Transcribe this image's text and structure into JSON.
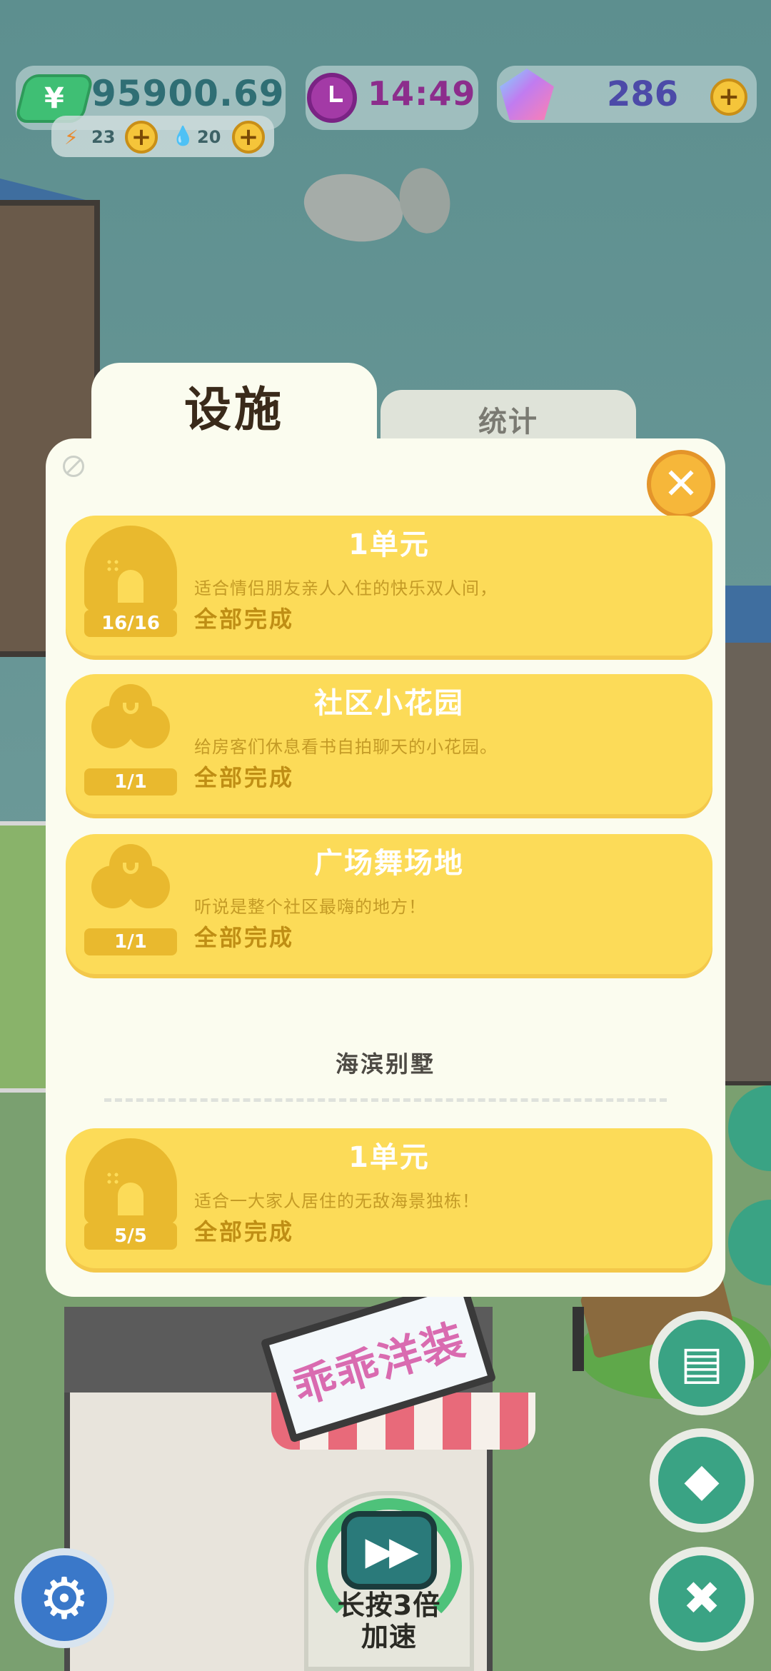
{
  "hud": {
    "money": "95900.69",
    "money_symbol": "¥",
    "energy": "23",
    "water": "20",
    "time": "14:49",
    "gems": "286",
    "plus": "+"
  },
  "tabs": [
    {
      "label": "设施",
      "active": true
    },
    {
      "label": "统计",
      "active": false
    }
  ],
  "close_symbol": "✕",
  "cards": [
    {
      "icon": "house-icon",
      "count": "16/16",
      "title": "1单元",
      "desc": "适合情侣朋友亲人入住的快乐双人间，",
      "status": "全部完成"
    },
    {
      "icon": "tree-icon",
      "count": "1/1",
      "title": "社区小花园",
      "desc": "给房客们休息看书自拍聊天的小花园。",
      "status": "全部完成"
    },
    {
      "icon": "tree-icon",
      "count": "1/1",
      "title": "广场舞场地",
      "desc": "听说是整个社区最嗨的地方！",
      "status": "全部完成"
    }
  ],
  "section": {
    "header": "海滨别墅",
    "cards": [
      {
        "icon": "house-icon",
        "count": "5/5",
        "title": "1单元",
        "desc": "适合一大家人居住的无敌海景独栋！",
        "status": "全部完成"
      }
    ]
  },
  "bottom": {
    "speed_label_line1": "长按3倍",
    "speed_label_line2": "加速",
    "settings_icon": "gear-icon",
    "notes_icon": "notes-icon",
    "gem_shop_icon": "gem-shop-icon",
    "tools_icon": "tools-icon"
  },
  "background": {
    "shop_sign": "乖乖洋装"
  },
  "colors": {
    "card_yellow": "#fcdb58",
    "panel_bg": "#fbfcef",
    "close_orange": "#f6b73a",
    "status_text": "#bf8e14"
  }
}
